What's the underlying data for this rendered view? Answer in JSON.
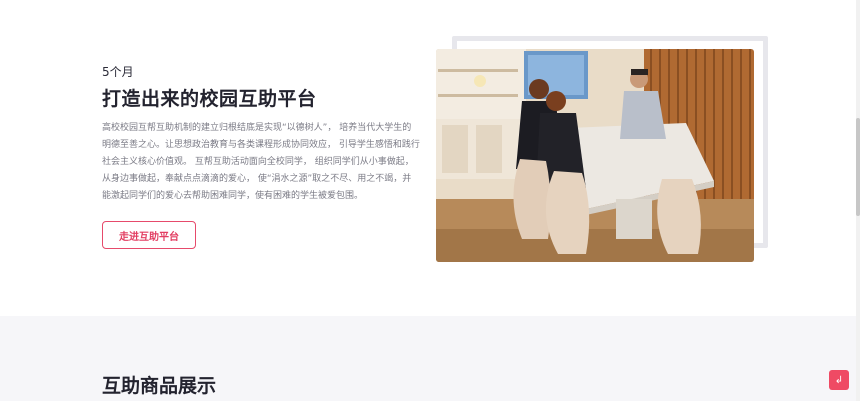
{
  "hero": {
    "eyebrow": "5个月",
    "title": "打造出来的校园互助平台",
    "description": "高校校园互帮互助机制的建立归根结底是实现“以德树人”， 培养当代大学生的明德至善之心。让思想政治教育与各类课程形成协同效应， 引导学生感悟和践行社会主义核心价值观。 互帮互助活动面向全校同学， 组织同学们从小事做起， 从身边事做起，奉献点点滴滴的爱心， 使“涓水之源”取之不尽、用之不竭，并能激起同学们的爱心去帮助困难同学，使有困难的学生被爱包围。",
    "cta_label": "走进互助平台",
    "accent_color": "#e23e62"
  },
  "products": {
    "title": "互助商品展示"
  },
  "fab": {
    "icon": "back-to-top-icon",
    "glyph": "↲",
    "color": "#ef4a64"
  }
}
